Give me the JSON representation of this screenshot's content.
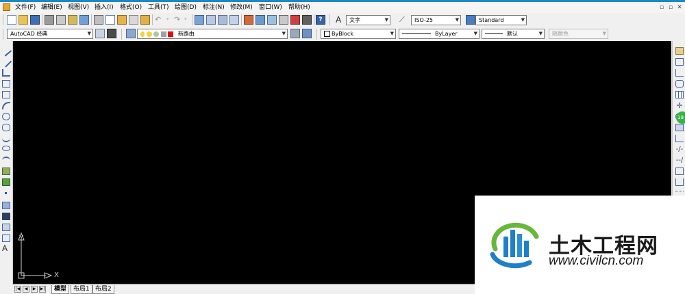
{
  "menu": {
    "items": [
      "文件(F)",
      "编辑(E)",
      "视图(V)",
      "插入(I)",
      "格式(O)",
      "工具(T)",
      "绘图(D)",
      "标注(N)",
      "修改(M)",
      "窗口(W)",
      "帮助(H)"
    ]
  },
  "window_controls": {
    "minimize": "▫",
    "restore": "▫",
    "close": "✕"
  },
  "toolbar1": {
    "text_style": "文字",
    "dim_style": "ISO-25",
    "table_style": "Standard"
  },
  "toolbar2": {
    "workspace": "AutoCAD 经典",
    "layer": "新路由",
    "color": "ByBlock",
    "linetype": "ByLayer",
    "lineweight": "默认",
    "plotstyle": "随颜色"
  },
  "ucs": {
    "y_label": "Y",
    "x_label": "X"
  },
  "layout_tabs": [
    "模型",
    "布局1",
    "布局2"
  ],
  "side_badge": "19",
  "watermark": {
    "title": "土木工程网",
    "url": "www.civilcn.com"
  },
  "colors": {
    "canvas": "#000000",
    "accent": "#1e88c7",
    "logo_blue": "#1f7fc8",
    "logo_green": "#67b83a"
  }
}
